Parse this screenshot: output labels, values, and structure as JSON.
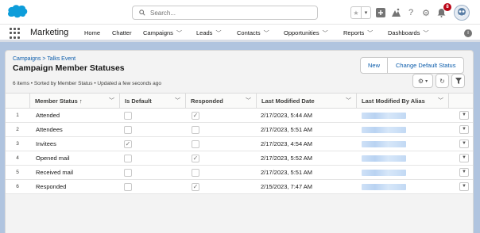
{
  "header": {
    "search_placeholder": "Search...",
    "notification_count": "8"
  },
  "nav": {
    "app_name": "Marketing",
    "items": [
      {
        "label": "Home",
        "dropdown": false
      },
      {
        "label": "Chatter",
        "dropdown": false
      },
      {
        "label": "Campaigns",
        "dropdown": true
      },
      {
        "label": "Leads",
        "dropdown": true
      },
      {
        "label": "Contacts",
        "dropdown": true
      },
      {
        "label": "Opportunities",
        "dropdown": true
      },
      {
        "label": "Reports",
        "dropdown": true
      },
      {
        "label": "Dashboards",
        "dropdown": true
      }
    ]
  },
  "page": {
    "breadcrumb": "Campaigns > Talks Event",
    "title": "Campaign Member Statuses",
    "meta": "6 items • Sorted by Member Status • Updated a few seconds ago",
    "buttons": {
      "new": "New",
      "change_default": "Change Default Status"
    }
  },
  "table": {
    "columns": {
      "status": "Member Status",
      "default": "Is Default",
      "responded": "Responded",
      "modified": "Last Modified Date",
      "alias": "Last Modified By Alias"
    },
    "rows": [
      {
        "num": "1",
        "status": "Attended",
        "is_default": false,
        "responded": true,
        "modified": "2/17/2023, 5:44 AM"
      },
      {
        "num": "2",
        "status": "Attendees",
        "is_default": false,
        "responded": false,
        "modified": "2/17/2023, 5:51 AM"
      },
      {
        "num": "3",
        "status": "Invitees",
        "is_default": true,
        "responded": false,
        "modified": "2/17/2023, 4:54 AM"
      },
      {
        "num": "4",
        "status": "Opened mail",
        "is_default": false,
        "responded": true,
        "modified": "2/17/2023, 5:52 AM"
      },
      {
        "num": "5",
        "status": "Received mail",
        "is_default": false,
        "responded": false,
        "modified": "2/17/2023, 5:51 AM"
      },
      {
        "num": "6",
        "status": "Responded",
        "is_default": false,
        "responded": true,
        "modified": "2/15/2023, 7:47 AM"
      }
    ]
  }
}
